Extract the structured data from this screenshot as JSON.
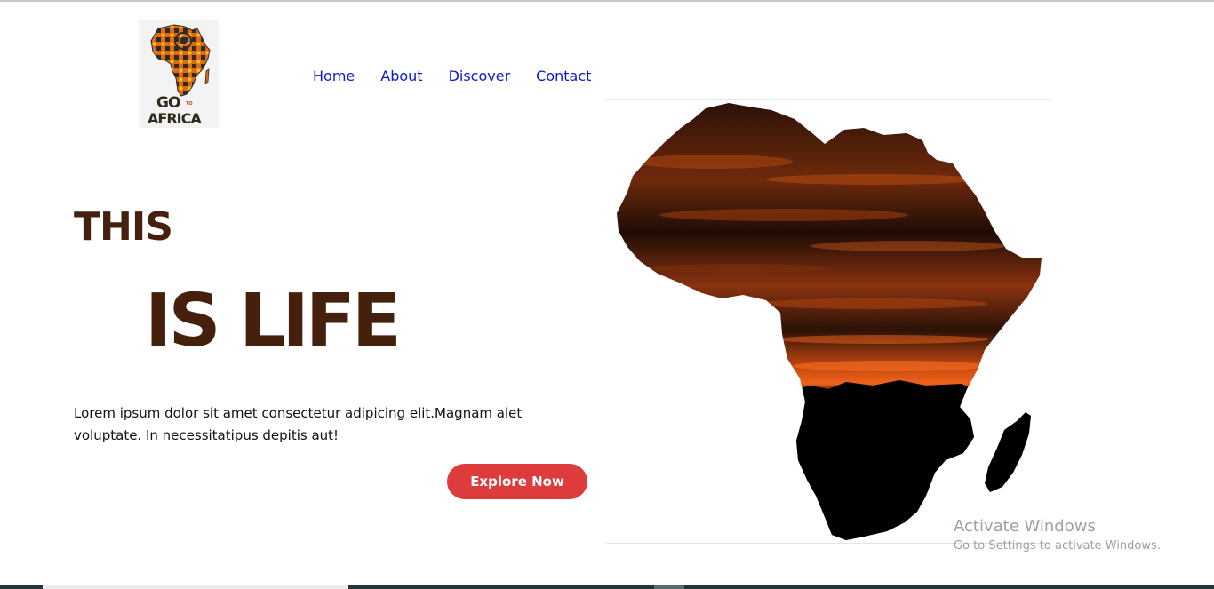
{
  "logo": {
    "line1": "GO",
    "line2": "TO",
    "line3": "AFRICA"
  },
  "nav": {
    "items": [
      {
        "label": "Home"
      },
      {
        "label": "About"
      },
      {
        "label": "Discover"
      },
      {
        "label": "Contact"
      }
    ]
  },
  "hero": {
    "title_line1": "THIS",
    "title_line2": "IS LIFE",
    "description": "Lorem ipsum dolor sit amet consectetur adipicing elit.Magnam alet voluptate. In necessitatipus depitis aut!",
    "button_label": "Explore Now"
  },
  "watermark": {
    "title": "Activate Windows",
    "subtitle": "Go to Settings to activate Windows."
  },
  "colors": {
    "nav_link": "#0b1ad1",
    "heading": "#45200c",
    "button": "#de3c3c"
  },
  "icons": {
    "logo": "africa-map-logo-icon",
    "hero": "africa-silhouette-sunset-image"
  }
}
